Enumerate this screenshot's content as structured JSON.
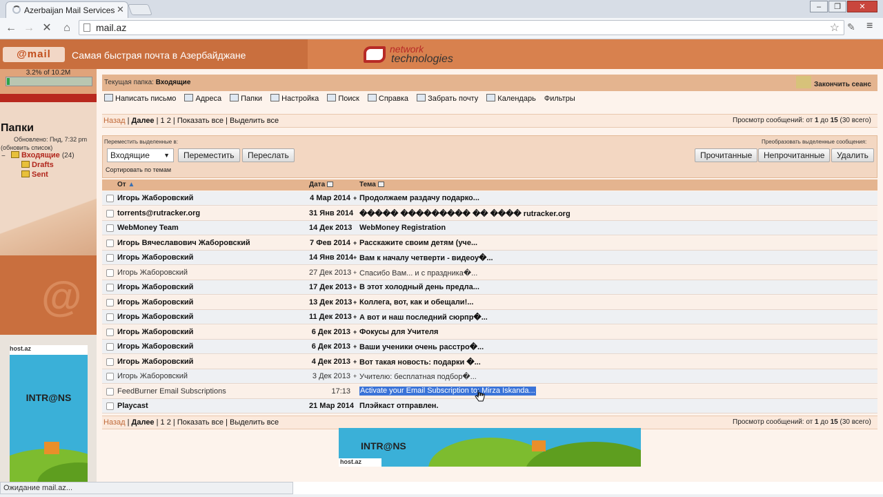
{
  "browser": {
    "tab_title": "Azerbaijan Mail Services",
    "tab_close": "✕",
    "url": "mail.az",
    "status_text": "Ожидание mail.az...",
    "window_buttons": [
      "–",
      "❐",
      "✕"
    ]
  },
  "header": {
    "logo_text": "@mail",
    "tagline": "Самая быстрая почта в Азербайджане",
    "partner_line1": "network",
    "partner_line2": "technologies"
  },
  "sidebar": {
    "quota_text": "3.2% of 10.2M",
    "quota_percent": 3.2,
    "folders_title": "Папки",
    "updated": "Обновлено: Пнд, 7:32 pm",
    "refresh": "(обновить список)",
    "tree_toggle": "−",
    "folders": [
      {
        "label": "Входящие",
        "count": "(24)"
      },
      {
        "label": "Drafts",
        "count": ""
      },
      {
        "label": "Sent",
        "count": ""
      }
    ],
    "ad_host": "host.az",
    "ad_brand": "INTR@NS"
  },
  "main": {
    "current_folder_label": "Текущая папка:",
    "current_folder": "Входящие",
    "logout": "Закончить сеанс",
    "menu": [
      {
        "label": "Написать письмо",
        "icon": "compose-icon"
      },
      {
        "label": "Адреса",
        "icon": "addressbook-icon"
      },
      {
        "label": "Папки",
        "icon": "folders-icon"
      },
      {
        "label": "Настройка",
        "icon": "settings-icon"
      },
      {
        "label": "Поиск",
        "icon": "search-icon"
      },
      {
        "label": "Справка",
        "icon": "help-icon"
      },
      {
        "label": "Забрать почту",
        "icon": "fetch-mail-icon"
      },
      {
        "label": "Календарь",
        "icon": "calendar-icon"
      },
      {
        "label": "Фильтры",
        "icon": ""
      }
    ],
    "pager": {
      "back": "Назад",
      "sep": "|",
      "next": "Далее",
      "page1": "1",
      "page2": "2",
      "show_all": "Показать все",
      "select_all": "Выделить все",
      "viewing_prefix": "Просмотр сообщений: от",
      "from": "1",
      "to_word": "до",
      "to": "15",
      "total": "(30 всего)"
    },
    "actions": {
      "move_label": "Переместить выделенные в:",
      "convert_label": "Преобразовать выделенные сообщения:",
      "folder_select": "Входящие",
      "move_btn": "Переместить",
      "forward_btn": "Переслать",
      "read_btn": "Прочитанные",
      "unread_btn": "Непрочитанные",
      "delete_btn": "Удалить",
      "sort_label": "Сортировать по темам"
    },
    "columns": {
      "from": "От",
      "date": "Дата",
      "subject": "Тема"
    },
    "messages": [
      {
        "from": "Игорь Жаборовский",
        "date": "4 Мар 2014",
        "att": "+",
        "subject": "Продолжаем раздачу подарко...",
        "unread": true
      },
      {
        "from": "torrents@rutracker.org",
        "date": "31 Янв 2014",
        "att": "",
        "subject": "����� ��������� �� ���� rutracker.org",
        "unread": true
      },
      {
        "from": "WebMoney Team",
        "date": "14 Дек 2013",
        "att": "",
        "subject": "WebMoney Registration",
        "unread": true
      },
      {
        "from": "Игорь Вячеславович Жаборовский",
        "date": "7 Фев 2014",
        "att": "+",
        "subject": "Расскажите своим детям (уче...",
        "unread": true
      },
      {
        "from": "Игорь Жаборовский",
        "date": "14 Янв 2014",
        "att": "+",
        "subject": "Вам к началу четверти - видеоу�...",
        "unread": true
      },
      {
        "from": "Игорь Жаборовский",
        "date": "27 Дек 2013",
        "att": "+",
        "subject": "Спасибо Вам... и с праздника�...",
        "unread": false
      },
      {
        "from": "Игорь Жаборовский",
        "date": "17 Дек 2013",
        "att": "+",
        "subject": "В этот холодный день предла...",
        "unread": true
      },
      {
        "from": "Игорь Жаборовский",
        "date": "13 Дек 2013",
        "att": "+",
        "subject": "Коллега, вот, как и обещали!...",
        "unread": true
      },
      {
        "from": "Игорь Жаборовский",
        "date": "11 Дек 2013",
        "att": "+",
        "subject": "А вот и наш последний сюрпр�...",
        "unread": true
      },
      {
        "from": "Игорь Жаборовский",
        "date": "6 Дек 2013",
        "att": "+",
        "subject": "Фокусы для Учителя",
        "unread": true
      },
      {
        "from": "Игорь Жаборовский",
        "date": "6 Дек 2013",
        "att": "+",
        "subject": "Ваши ученики очень расстро�...",
        "unread": true
      },
      {
        "from": "Игорь Жаборовский",
        "date": "4 Дек 2013",
        "att": "+",
        "subject": "Вот такая новость: подарки �...",
        "unread": true
      },
      {
        "from": "Игорь Жаборовский",
        "date": "3 Дек 2013",
        "att": "+",
        "subject": "Учителю: бесплатная подбор�...",
        "unread": false
      },
      {
        "from": "FeedBurner Email Subscriptions",
        "date": "17:13",
        "att": "",
        "subject": "Activate your Email Subscription to: Mirza Iskanda...",
        "unread": false,
        "selected": true
      },
      {
        "from": "Playcast",
        "date": "21 Мар 2014",
        "att": "",
        "subject": "Плэйкаст отправлен.",
        "unread": true
      }
    ],
    "bottom_ad_brand": "INTR@NS",
    "bottom_ad_host": "host.az"
  }
}
